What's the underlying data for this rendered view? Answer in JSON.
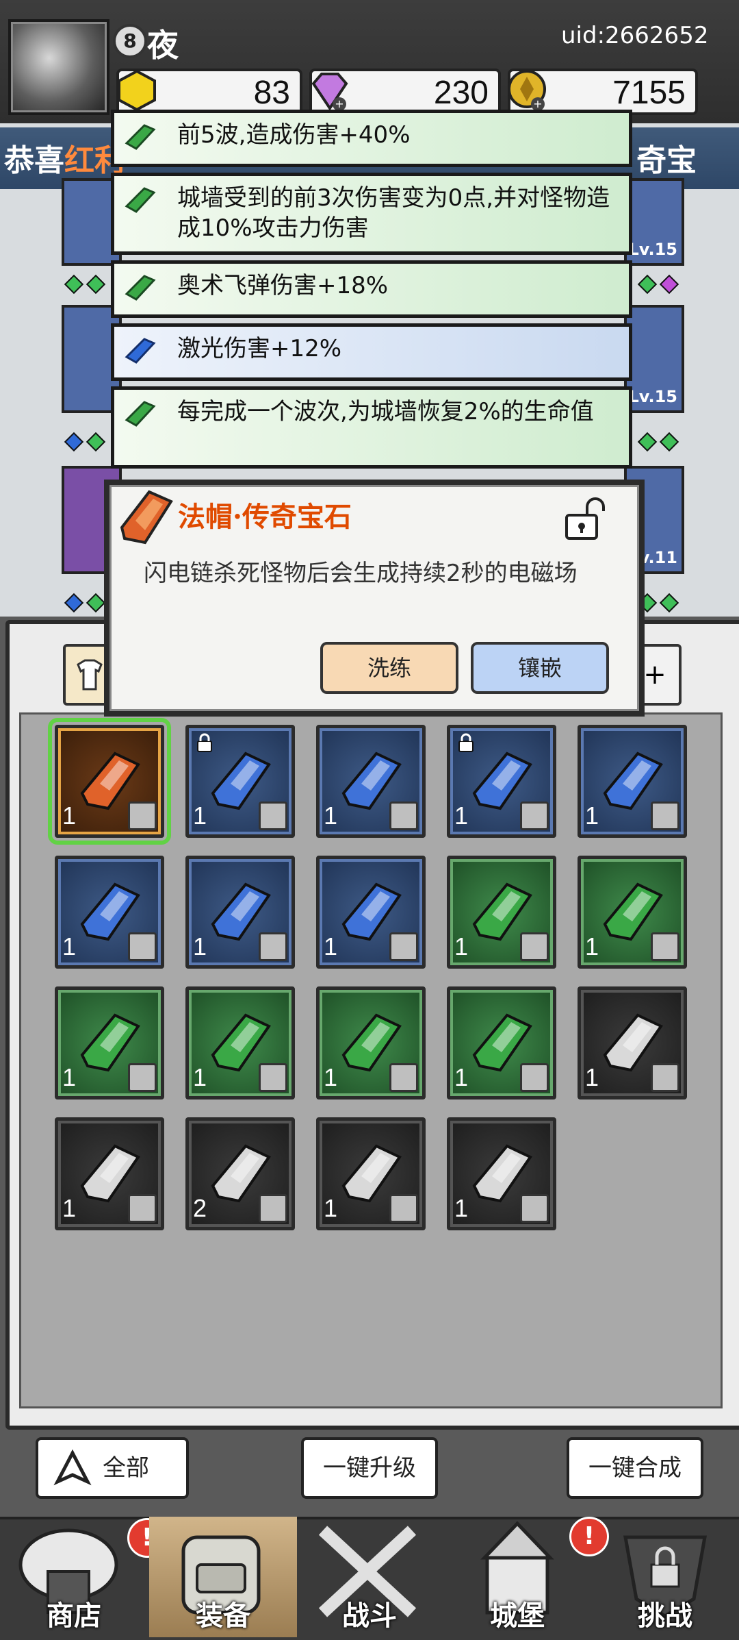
{
  "player": {
    "level": "8",
    "name": "夜",
    "uid": "uid:2662652"
  },
  "resources": {
    "gold_gem": "83",
    "diamond": "230",
    "coin": "7155"
  },
  "announcement": {
    "left": "恭喜",
    "left_highlight": "红利",
    "right": "奇宝石!"
  },
  "buffs": [
    {
      "text": "前5波,造成伤害+40%",
      "color": "green"
    },
    {
      "text": "城墙受到的前3次伤害变为0点,并对怪物造成10%攻击力伤害",
      "color": "green"
    },
    {
      "text": "奥术飞弹伤害+18%",
      "color": "green"
    },
    {
      "text": "激光伤害+12%",
      "color": "blue"
    },
    {
      "text": "每完成一个波次,为城墙恢复2%的生命值",
      "color": "green"
    }
  ],
  "gear_levels": [
    "Lv.15",
    "Lv.15",
    "Lv.11"
  ],
  "tooltip": {
    "title": "法帽·传奇宝石",
    "description": "闪电链杀死怪物后会生成持续2秒的电磁场",
    "reroll_label": "洗练",
    "inlay_label": "镶嵌"
  },
  "inventory": [
    {
      "rarity": "orange",
      "count": "1",
      "locked": false,
      "gem": "#e0622a"
    },
    {
      "rarity": "blue",
      "count": "1",
      "locked": true,
      "gem": "#3f72d8"
    },
    {
      "rarity": "blue",
      "count": "1",
      "locked": false,
      "gem": "#3f72d8"
    },
    {
      "rarity": "blue",
      "count": "1",
      "locked": true,
      "gem": "#3f72d8"
    },
    {
      "rarity": "blue",
      "count": "1",
      "locked": false,
      "gem": "#3f72d8"
    },
    {
      "rarity": "blue",
      "count": "1",
      "locked": false,
      "gem": "#3f72d8"
    },
    {
      "rarity": "blue",
      "count": "1",
      "locked": false,
      "gem": "#3f72d8"
    },
    {
      "rarity": "blue",
      "count": "1",
      "locked": false,
      "gem": "#3f72d8"
    },
    {
      "rarity": "green",
      "count": "1",
      "locked": false,
      "gem": "#3aa846"
    },
    {
      "rarity": "green",
      "count": "1",
      "locked": false,
      "gem": "#3aa846"
    },
    {
      "rarity": "green",
      "count": "1",
      "locked": false,
      "gem": "#3aa846"
    },
    {
      "rarity": "green",
      "count": "1",
      "locked": false,
      "gem": "#3aa846"
    },
    {
      "rarity": "green",
      "count": "1",
      "locked": false,
      "gem": "#3aa846"
    },
    {
      "rarity": "green",
      "count": "1",
      "locked": false,
      "gem": "#3aa846"
    },
    {
      "rarity": "black",
      "count": "1",
      "locked": false,
      "gem": "#d9d9d9"
    },
    {
      "rarity": "black",
      "count": "1",
      "locked": false,
      "gem": "#d9d9d9"
    },
    {
      "rarity": "black",
      "count": "2",
      "locked": false,
      "gem": "#d9d9d9"
    },
    {
      "rarity": "black",
      "count": "1",
      "locked": false,
      "gem": "#d9d9d9"
    },
    {
      "rarity": "black",
      "count": "1",
      "locked": false,
      "gem": "#d9d9d9"
    }
  ],
  "actions": {
    "filter_label": "全部",
    "upgrade_all_label": "一键升级",
    "merge_all_label": "一键合成"
  },
  "nav": [
    {
      "label": "商店",
      "badge": "!"
    },
    {
      "label": "装备",
      "badge": ""
    },
    {
      "label": "战斗",
      "badge": ""
    },
    {
      "label": "城堡",
      "badge": "!"
    },
    {
      "label": "挑战",
      "badge": ""
    }
  ]
}
